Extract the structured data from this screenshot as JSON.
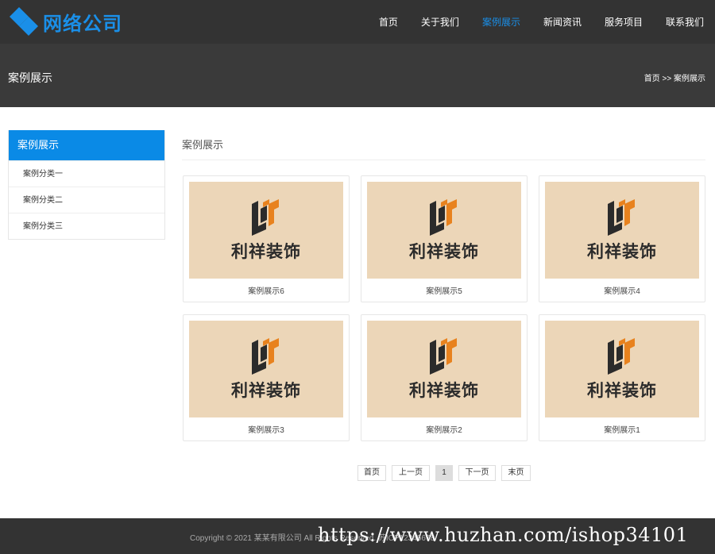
{
  "header": {
    "logo_text": "网络公司",
    "nav": [
      {
        "label": "首页"
      },
      {
        "label": "关于我们"
      },
      {
        "label": "案例展示",
        "active": true
      },
      {
        "label": "新闻资讯"
      },
      {
        "label": "服务项目"
      },
      {
        "label": "联系我们"
      }
    ],
    "accent_color": "#1a8fe8"
  },
  "banner": {
    "title": "案例展示",
    "breadcrumb": {
      "home": "首页",
      "sep": ">>",
      "current": "案例展示"
    }
  },
  "sidebar": {
    "title": "案例展示",
    "items": [
      {
        "label": "案例分类一"
      },
      {
        "label": "案例分类二"
      },
      {
        "label": "案例分类三"
      }
    ]
  },
  "content": {
    "title": "案例展示",
    "cards": [
      {
        "image_text": "利祥装饰",
        "caption": "案例展示6"
      },
      {
        "image_text": "利祥装饰",
        "caption": "案例展示5"
      },
      {
        "image_text": "利祥装饰",
        "caption": "案例展示4"
      },
      {
        "image_text": "利祥装饰",
        "caption": "案例展示3"
      },
      {
        "image_text": "利祥装饰",
        "caption": "案例展示2"
      },
      {
        "image_text": "利祥装饰",
        "caption": "案例展示1"
      }
    ]
  },
  "pagination": {
    "first": "首页",
    "prev": "上一页",
    "current": "1",
    "next": "下一页",
    "last": "末页"
  },
  "footer": {
    "copyright": "Copyright © 2021 某某有限公司 All Rights Reserved. 苏ICP12345678",
    "watermark": "https://www.huzhan.com/ishop34101"
  }
}
